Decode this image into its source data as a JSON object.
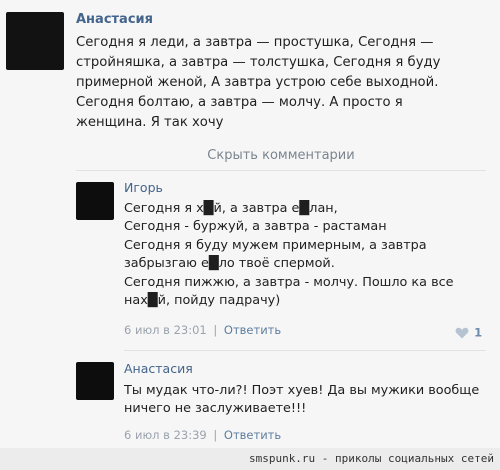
{
  "post": {
    "author": "Анастасия",
    "lines": [
      "Сегодня я леди, а завтра — простушка, Сегодня —",
      "стройняшка, а завтра — толстушка, Сегодня я буду",
      "примерной женой, А завтра устрою себе выходной.",
      "Сегодня болтаю, а завтра — молчу. А просто я",
      "женщина. Я так хочу"
    ]
  },
  "comments_toggle": "Скрыть комментарии",
  "comments": [
    {
      "author": "Игорь",
      "lines": [
        "Сегодня я х█й, а завтра е█лан,",
        "Сегодня - буржуй, а завтра - растаман",
        "Сегодня я буду мужем примерным, а завтра",
        "забрызгаю е█ло твоё спермой.",
        "Сегодня пижжю, а завтра - молчу. Пошло ка все",
        "нах█й, пойду падрачу)"
      ],
      "date": "6 июл в 23:01",
      "separator": "|",
      "reply_label": "Ответить",
      "likes": "1"
    },
    {
      "author": "Анастасия",
      "lines": [
        "Ты мудак что-ли?! Поэт хуев! Да вы мужики вообще",
        "ничего не заслуживаете!!!"
      ],
      "date": "6 июл в 23:39",
      "separator": "|",
      "reply_label": "Ответить"
    }
  ],
  "watermark": "smspunk.ru - приколы социальных сетей",
  "colors": {
    "author": "#43648c",
    "background": "#f6f6f6",
    "heart": "#b6c3d1"
  }
}
